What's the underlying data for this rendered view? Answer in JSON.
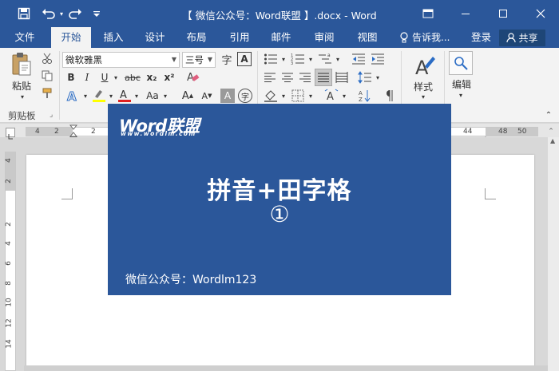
{
  "window": {
    "title": "【 微信公众号：Word联盟 】.docx - Word"
  },
  "tabs": [
    {
      "label": "文件"
    },
    {
      "label": "开始"
    },
    {
      "label": "插入"
    },
    {
      "label": "设计"
    },
    {
      "label": "布局"
    },
    {
      "label": "引用"
    },
    {
      "label": "邮件"
    },
    {
      "label": "审阅"
    },
    {
      "label": "视图"
    }
  ],
  "active_tab": "开始",
  "tellme": "告诉我...",
  "login": "登录",
  "share": "共享",
  "ribbon": {
    "paste_label": "粘贴",
    "clipboard_group": "剪贴板",
    "font_name": "微软雅黑",
    "font_size": "三号",
    "bold": "B",
    "italic": "I",
    "underline": "U",
    "strike": "abc",
    "subscript": "x₂",
    "superscript": "x²",
    "font_color_glyph": "A",
    "change_case": "Aa",
    "grow_font": "A",
    "shrink_font": "A",
    "clear_format": "A",
    "phonetic": "字",
    "enclose": "字",
    "styles_label": "样式",
    "editing_label": "编辑"
  },
  "ruler": {
    "h_ticks": [
      "4",
      "2",
      "2",
      "44",
      "48",
      "50"
    ],
    "v_ticks": [
      "4",
      "2",
      "2",
      "4",
      "6",
      "8",
      "10",
      "12",
      "14"
    ]
  },
  "card": {
    "logo": "Word联盟",
    "logo_url": "www.wordlm.com",
    "headline": "拼音+田字格",
    "numeral": "①",
    "footer": "微信公众号：Wordlm123"
  },
  "colors": {
    "word_blue": "#2b579a",
    "ribbon_bg": "#f3f3f3",
    "highlight_yellow": "#ffff00",
    "font_red": "#e02020"
  }
}
